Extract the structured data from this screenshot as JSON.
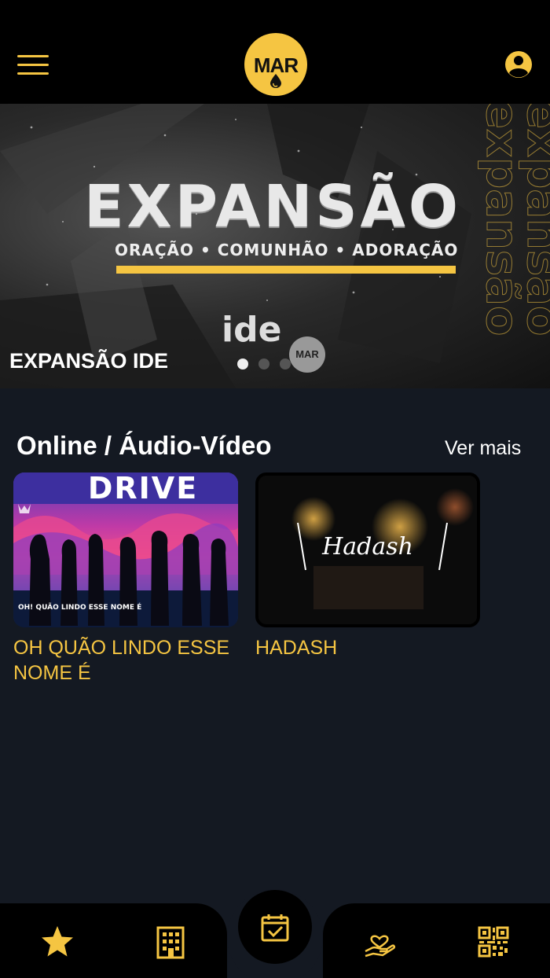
{
  "header": {
    "menu_icon": "hamburger-menu-icon",
    "logo_text": "MAR",
    "profile_icon": "user-circle-icon",
    "accent_color": "#f5c542"
  },
  "banner": {
    "headline": "EXPANSÃO",
    "subline": "ORAÇÃO • COMUNHÃO • ADORAÇÃO",
    "vertical_text": "expansão",
    "ide_text": "ide",
    "mar_text": "MAR",
    "caption": "EXPANSÃO IDE",
    "slides_total": 3,
    "active_slide": 1
  },
  "section": {
    "title": "Online / Áudio-Vídeo",
    "see_more": "Ver mais",
    "cards": [
      {
        "title": "OH QUÃO LINDO ESSE NOME É",
        "thumb_heading": "DRIVE",
        "thumb_caption": "OH! QUÃO LINDO ESSE NOME É"
      },
      {
        "title": "HADASH",
        "thumb_heading": "Hadash"
      }
    ]
  },
  "bottom_nav": {
    "items": [
      {
        "icon": "star-icon"
      },
      {
        "icon": "building-icon"
      },
      {
        "icon": "calendar-check-icon"
      },
      {
        "icon": "hand-heart-icon"
      },
      {
        "icon": "qr-code-icon"
      }
    ]
  }
}
